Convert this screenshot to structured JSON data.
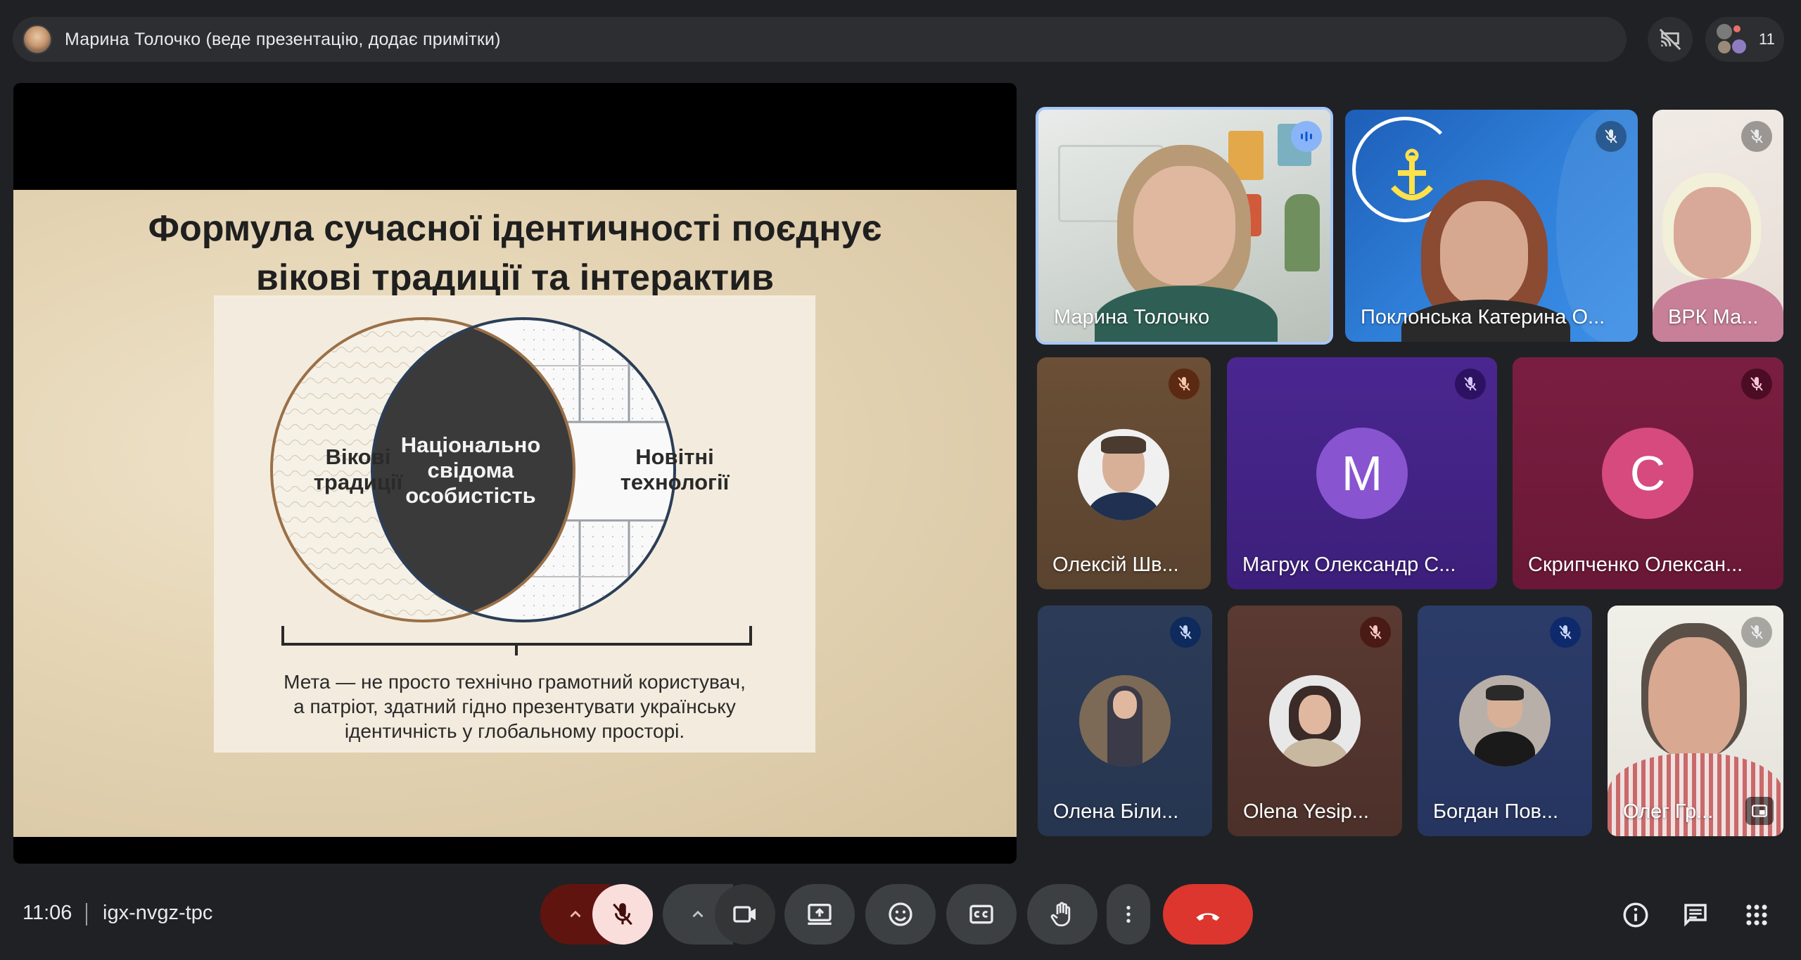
{
  "header": {
    "presenter_text": "Марина Толочко (веде презентацію, додає примітки)",
    "participant_count": "11"
  },
  "slide": {
    "title_line1": "Формула сучасної ідентичності поєднує",
    "title_line2": "вікові традиції та інтерактив",
    "left_label_line1": "Вікові",
    "left_label_line2": "традиції",
    "center_label_line1": "Національно",
    "center_label_line2": "свідома",
    "center_label_line3": "особистість",
    "right_label_line1": "Новітні",
    "right_label_line2": "технології",
    "goal_line1": "Мета — не просто технічно грамотний користувач,",
    "goal_line2": "а патріот, здатний гідно презентувати українську",
    "goal_line3": "ідентичність у глобальному просторі."
  },
  "participants": [
    {
      "name": "Марина Толочко",
      "state": "speaking",
      "video": true
    },
    {
      "name": "Поклонська Катерина О...",
      "state": "muted",
      "video": true
    },
    {
      "name": "ВРК Ма...",
      "state": "muted",
      "video": true
    },
    {
      "name": "Олексій Шв...",
      "state": "muted",
      "video": false
    },
    {
      "name": "Магрук Олександр С...",
      "state": "muted",
      "video": false,
      "initial": "М"
    },
    {
      "name": "Скрипченко Олексан...",
      "state": "muted",
      "video": false,
      "initial": "С"
    },
    {
      "name": "Олена Біли...",
      "state": "muted",
      "video": false
    },
    {
      "name": "Olena Yesip...",
      "state": "muted",
      "video": false
    },
    {
      "name": "Богдан Пов...",
      "state": "muted",
      "video": false
    },
    {
      "name": "Олег Гр...",
      "state": "muted",
      "video": true
    }
  ],
  "footer": {
    "time": "11:06",
    "meeting_code": "igx-nvgz-tpc"
  },
  "colors": {
    "background": "#202124",
    "end_call": "#ea4335",
    "mic_off_bg": "#f9dedc",
    "active_speaker": "#a8c7fa"
  },
  "icons": [
    "presenter-avatar",
    "cast-off-icon",
    "people-icon",
    "mic-off-icon",
    "camera-icon",
    "present-screen-icon",
    "emoji-icon",
    "captions-icon",
    "raise-hand-icon",
    "more-options-icon",
    "end-call-icon",
    "info-icon",
    "chat-icon",
    "activities-icon"
  ]
}
